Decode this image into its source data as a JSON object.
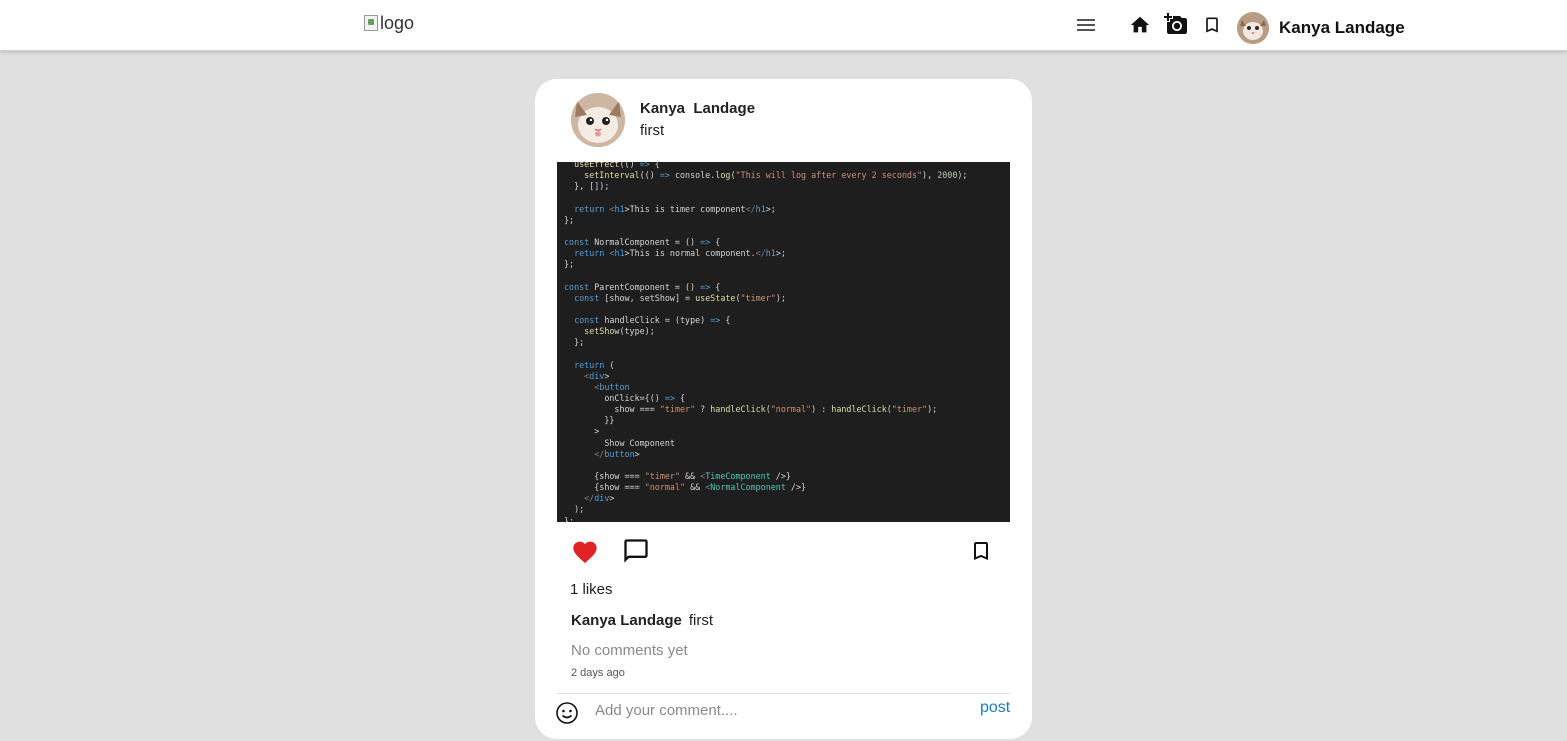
{
  "header": {
    "logo_alt": "logo",
    "user_name": "Kanya Landage"
  },
  "post": {
    "author": "Kanya  Landage",
    "caption_header": "first",
    "likes_text": "1 likes",
    "caption_user": "Kanya Landage",
    "caption_text": "first",
    "no_comments": "No comments yet",
    "time_ago": "2 days ago",
    "liked": true
  },
  "comment": {
    "placeholder": "Add your comment....",
    "post_label": "post"
  },
  "code_lines": [
    "  useEffect(() => {",
    "    setInterval(() => console.log(\"This will log after every 2 seconds\"), 2000);",
    "  }, []);",
    "",
    "  return <h1>This is timer component</h1>;",
    "};",
    "",
    "const NormalComponent = () => {",
    "  return <h1>This is normal component.</h1>;",
    "};",
    "",
    "const ParentComponent = () => {",
    "  const [show, setShow] = useState(\"timer\");",
    "",
    "  const handleClick = (type) => {",
    "    setShow(type);",
    "  };",
    "",
    "  return (",
    "    <div>",
    "      <button",
    "        onClick={() => {",
    "          show === \"timer\" ? handleClick(\"normal\") : handleClick(\"timer\");",
    "        }}",
    "      >",
    "        Show Component",
    "      </button>",
    "",
    "      {show === \"timer\" && <TimeComponent />}",
    "      {show === \"normal\" && <NormalComponent />}",
    "    </div>",
    "  );",
    "};"
  ],
  "colors": {
    "like": "#e02424",
    "post_link": "#1d7fc1",
    "page_bg": "#e0e0e0"
  },
  "icons": [
    "menu-icon",
    "home-icon",
    "add-photo-icon",
    "bookmark-icon",
    "heart-icon",
    "comment-icon",
    "smiley-icon"
  ]
}
